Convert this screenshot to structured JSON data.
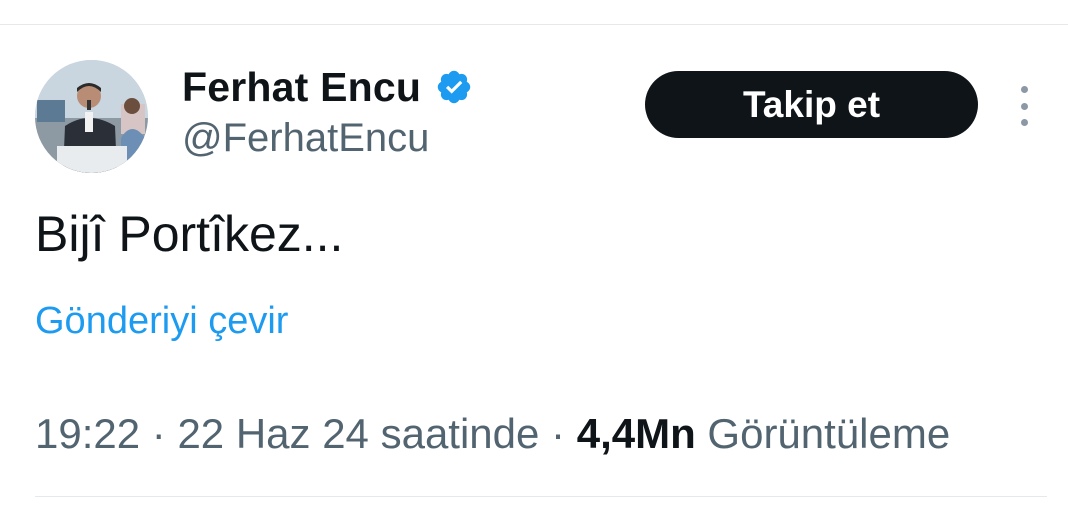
{
  "tweet": {
    "author": {
      "display_name": "Ferhat Encu",
      "handle": "@FerhatEncu",
      "verified": true,
      "avatar_icon": "user-avatar"
    },
    "follow_label": "Takip et",
    "more_icon": "more-vertical-icon",
    "text": "Bijî Portîkez...",
    "translate_label": "Gönderiyi çevir",
    "time": "19:22",
    "separator": "·",
    "date_text": "22 Haz 24 saatinde",
    "views_count": "4,4Mn",
    "views_label": "Görüntüleme"
  },
  "colors": {
    "text_primary": "#0f1419",
    "text_secondary": "#536471",
    "link": "#1d9bf0",
    "verified_badge": "#1d9bf0",
    "button_bg": "#0f1419",
    "button_text": "#ffffff",
    "divider": "#e6e9eb"
  }
}
